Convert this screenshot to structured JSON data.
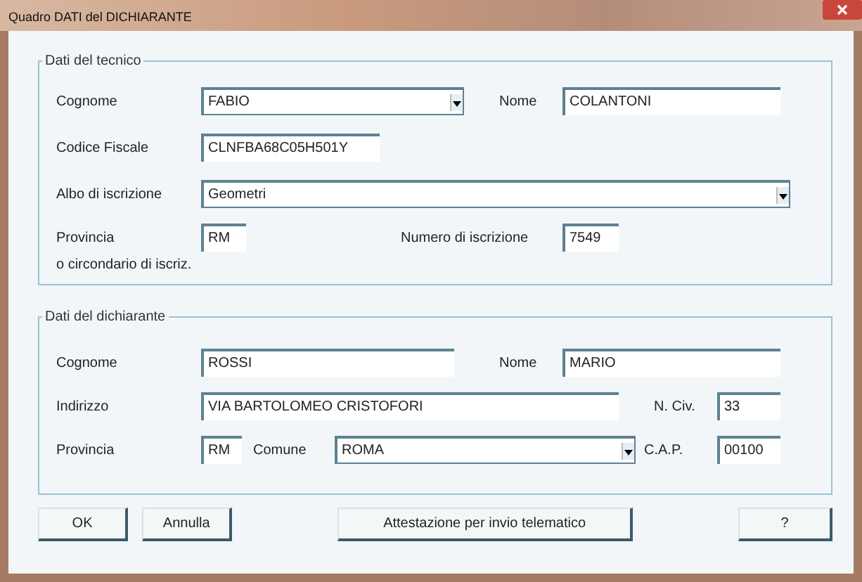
{
  "window": {
    "title": "Quadro DATI del DICHIARANTE"
  },
  "groups": [
    {
      "title": "Dati del tecnico",
      "fields": [
        {
          "label": "Cognome",
          "kind": "combo",
          "value": "FABIO"
        },
        {
          "label": "Nome",
          "kind": "field",
          "value": "COLANTONI"
        },
        {
          "label": "Codice Fiscale",
          "kind": "field",
          "value": "CLNFBA68C05H501Y"
        },
        {
          "label": "Albo di iscrizione",
          "kind": "combo",
          "value": "Geometri"
        },
        {
          "label": "Provincia",
          "note": "o circondario di iscriz.",
          "kind": "field",
          "value": "RM"
        },
        {
          "label": "Numero di iscrizione",
          "kind": "field",
          "value": "7549"
        }
      ]
    },
    {
      "title": "Dati del dichiarante",
      "fields": [
        {
          "label": "Cognome",
          "kind": "field",
          "value": "ROSSI"
        },
        {
          "label": "Nome",
          "kind": "field",
          "value": "MARIO"
        },
        {
          "label": "Indirizzo",
          "kind": "field",
          "value": "VIA BARTOLOMEO CRISTOFORI"
        },
        {
          "label": "N. Civ.",
          "kind": "field",
          "value": "33"
        },
        {
          "label": "Provincia",
          "kind": "field",
          "value": "RM"
        },
        {
          "label": "Comune",
          "kind": "combo",
          "value": "ROMA"
        },
        {
          "label": "C.A.P.",
          "kind": "field",
          "value": "00100"
        }
      ]
    }
  ],
  "buttons": [
    "OK",
    "Annulla",
    "Attestazione per invio telematico",
    "?"
  ]
}
